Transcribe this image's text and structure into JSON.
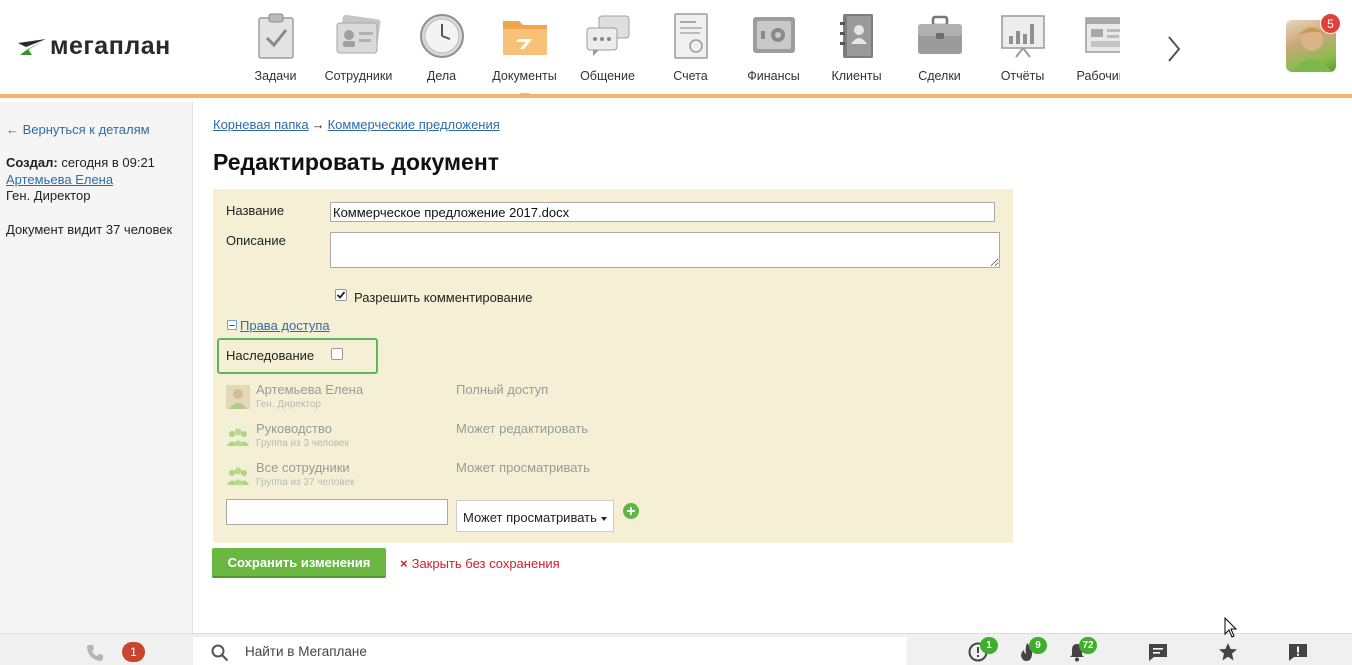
{
  "app": {
    "logo_text": "мегаплан"
  },
  "nav": {
    "items": [
      {
        "label": "Задачи",
        "icon": "tasks-icon"
      },
      {
        "label": "Сотрудники",
        "icon": "employees-icon"
      },
      {
        "label": "Дела",
        "icon": "clock-icon"
      },
      {
        "label": "Документы",
        "icon": "folder-icon",
        "active": true
      },
      {
        "label": "Общение",
        "icon": "chat-icon"
      },
      {
        "label": "Счета",
        "icon": "invoice-icon"
      },
      {
        "label": "Финансы",
        "icon": "safe-icon"
      },
      {
        "label": "Клиенты",
        "icon": "contacts-icon"
      },
      {
        "label": "Сделки",
        "icon": "briefcase-icon"
      },
      {
        "label": "Отчёты",
        "icon": "reports-icon"
      },
      {
        "label": "Рабочий с",
        "icon": "desktop-icon"
      }
    ],
    "avatar_badge": "5"
  },
  "sidebar": {
    "back_link": "←  Вернуться к деталям",
    "created_label": "Создал:",
    "created_time": " сегодня в 09:21",
    "author": "Артемьева Елена",
    "author_position": "Ген. Директор",
    "visibility": "Документ видит 37 человек"
  },
  "breadcrumb": {
    "root": "Корневая папка",
    "arrow": "→",
    "current": "Коммерческие предложения"
  },
  "page_title": "Редактировать документ",
  "form": {
    "name_label": "Название",
    "name_value": "Коммерческое предложение 2017.docx",
    "description_label": "Описание",
    "description_value": "",
    "allow_comments_label": "Разрешить комментирование",
    "allow_comments_checked": true,
    "access_rights_link": "Права доступа",
    "inheritance_label": "Наследование",
    "inheritance_checked": false,
    "permissions": [
      {
        "name": "Артемьева Елена",
        "sub": "Ген. Директор",
        "level": "Полный доступ",
        "type": "user"
      },
      {
        "name": "Руководство",
        "sub": "Группа из 3 человек",
        "level": "Может редактировать",
        "type": "group"
      },
      {
        "name": "Все сотрудники",
        "sub": "Группа из 37 человек",
        "level": "Может просматривать",
        "type": "group"
      }
    ],
    "add_select_value": "Может просматривать"
  },
  "actions": {
    "save": "Сохранить изменения",
    "close": "Закрыть без сохранения",
    "close_mark": "×"
  },
  "bottombar": {
    "phone_badge": "1",
    "search_placeholder": "Найти в Мегаплане",
    "badges": {
      "alerts": "1",
      "hot": "9",
      "notifications": "72"
    }
  },
  "colors": {
    "accent_orange": "#f4b26c",
    "save_green": "#6ab741",
    "link_blue": "#2f6ca6",
    "close_red": "#d0202a",
    "panel_bg": "#f5f0d5"
  }
}
